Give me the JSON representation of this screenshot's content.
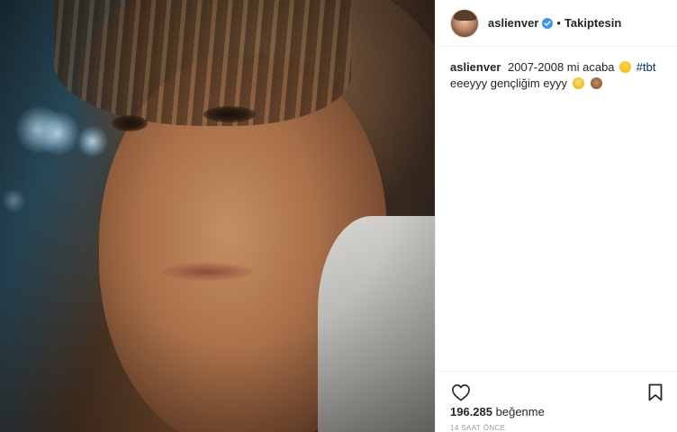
{
  "post": {
    "username": "aslienver",
    "verified": true,
    "separator": "•",
    "follow_status": "Takiptesin",
    "caption": {
      "username": "aslienver",
      "text_before": "2007-2008 mi acaba",
      "hashtag": "#tbt",
      "text_after": "eeeyyy gençliğim eyyy",
      "emojis": [
        "thinking-face-emoji",
        "grinning-face-emoji",
        "see-no-evil-monkey-emoji"
      ]
    },
    "likes_count": "196.285",
    "likes_label": "beğenme",
    "timestamp": "14 SAAT ÖNCE"
  },
  "icons": {
    "like": "heart-icon",
    "save": "bookmark-icon",
    "verified": "verified-badge-icon"
  },
  "colors": {
    "text": "#262626",
    "hashtag": "#003569",
    "verified": "#3897f0",
    "muted": "#999999",
    "divider": "#efefef"
  }
}
